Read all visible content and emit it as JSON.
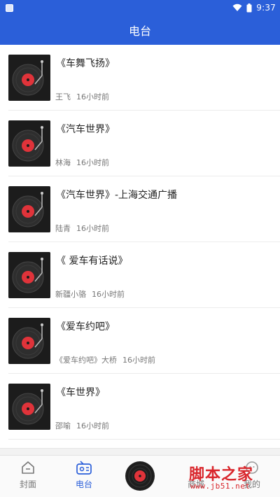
{
  "status": {
    "time": "9:37"
  },
  "header": {
    "title": "电台"
  },
  "items": [
    {
      "title": "《车舞飞扬》",
      "author": "王飞",
      "time": "16小时前"
    },
    {
      "title": "《汽车世界》",
      "author": "林海",
      "time": "16小时前"
    },
    {
      "title": "《汽车世界》-上海交通广播",
      "author": "陆青",
      "time": "16小时前"
    },
    {
      "title": "《 爱车有话说》",
      "author": "新疆小骆",
      "time": "16小时前"
    },
    {
      "title": "《爱车约吧》",
      "author": "《爱车约吧》大桥",
      "time": "16小时前"
    },
    {
      "title": "《车世界》",
      "author": "邵喻",
      "time": "16小时前"
    }
  ],
  "nav": {
    "home": "封面",
    "radio": "电台",
    "mall": "商城",
    "mine": "我的"
  },
  "watermark": {
    "main": "脚本之家",
    "url": "www.jb51.net"
  },
  "colors": {
    "brand": "#2b5fd9",
    "record_red": "#e0333a"
  }
}
